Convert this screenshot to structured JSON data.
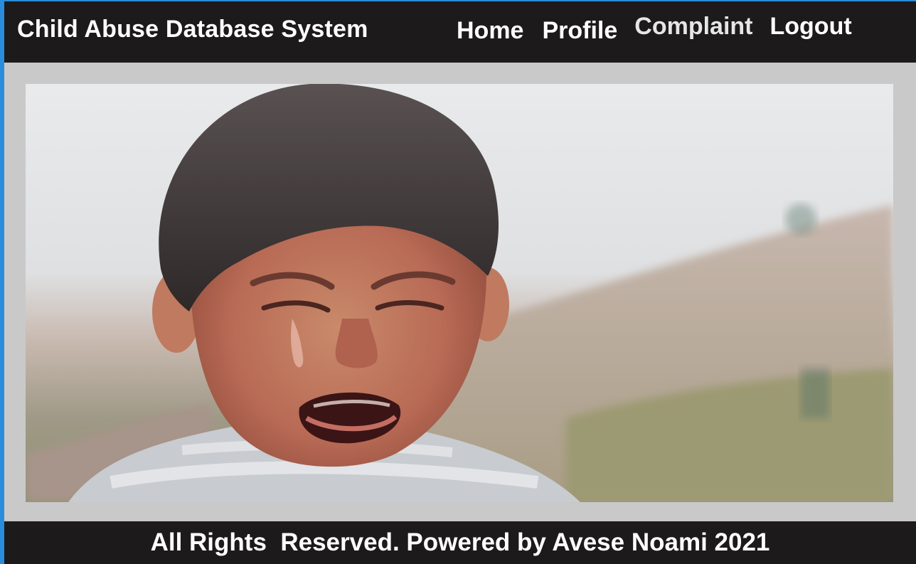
{
  "navbar": {
    "brand": "Child Abuse Database System",
    "links": [
      {
        "label": "Home"
      },
      {
        "label": "Profile"
      },
      {
        "label": "Complaint"
      },
      {
        "label": "Logout"
      }
    ]
  },
  "hero": {
    "image_icon": "crying-child-photo"
  },
  "footer": {
    "text": "All Rights  Reserved. Powered by Avese Noami 2021"
  },
  "colors": {
    "navbar_bg": "#1c1a1b",
    "page_bg": "#c9c9c9",
    "window_border": "#2a8ddb",
    "text": "#ffffff"
  }
}
